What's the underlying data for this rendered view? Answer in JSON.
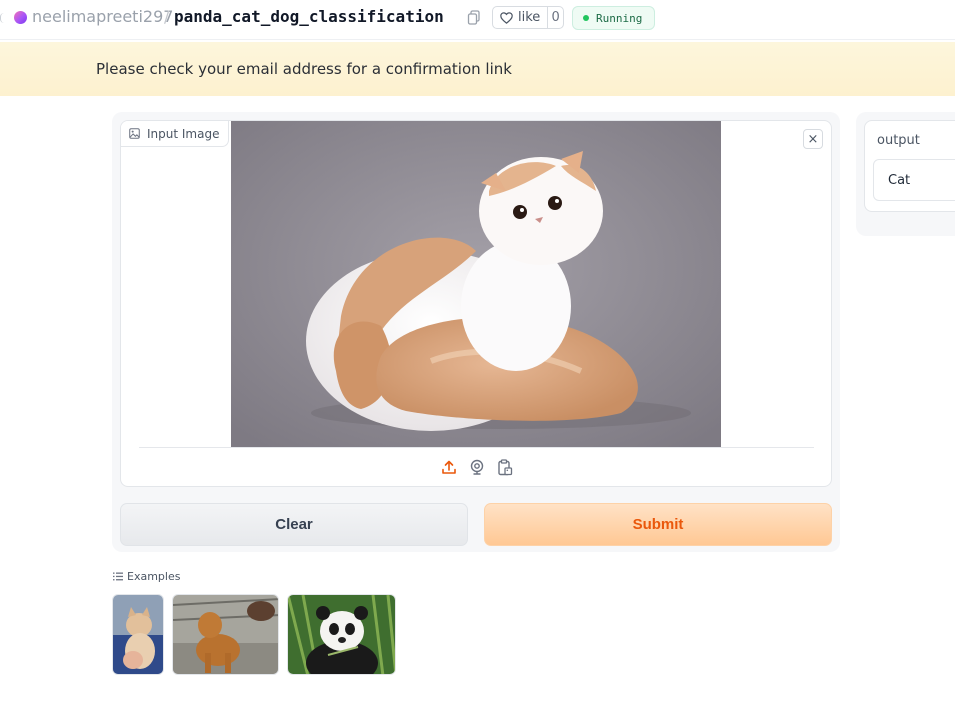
{
  "header": {
    "owner": "neelimapreeti297",
    "separator": "/",
    "repo": "panda_cat_dog_classification",
    "like_label": "like",
    "like_count": "0",
    "status": "Running"
  },
  "banner": {
    "message": "Please check your email address for a confirmation link"
  },
  "input": {
    "label": "Input Image",
    "close": "×",
    "sources": [
      "upload-icon",
      "webcam-icon",
      "clipboard-icon"
    ]
  },
  "buttons": {
    "clear": "Clear",
    "submit": "Submit"
  },
  "output": {
    "label": "output",
    "value": "Cat"
  },
  "examples": {
    "title": "Examples",
    "items": [
      "cat-example",
      "dog-example",
      "panda-example"
    ]
  },
  "colors": {
    "accent": "#ea580c",
    "status_green": "#22c55e",
    "banner_bg": "#fdf3d3"
  }
}
